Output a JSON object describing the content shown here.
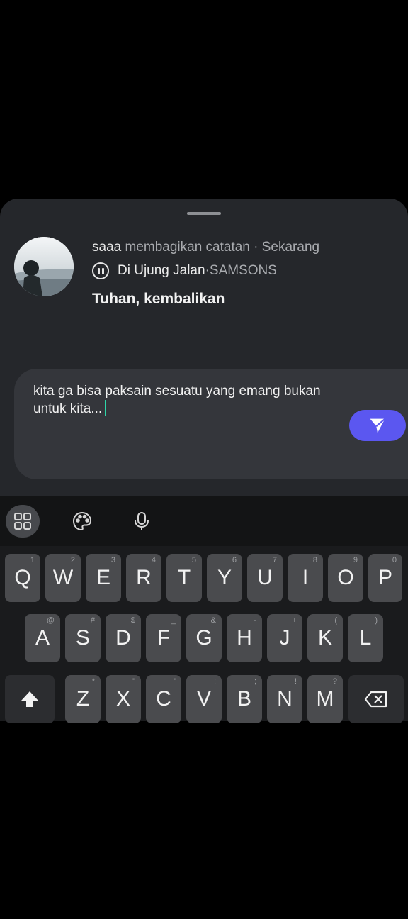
{
  "note": {
    "username": "saaa",
    "action_text": " membagikan catatan · Sekarang",
    "song_title": "Di Ujung Jalan",
    "song_separator": " · ",
    "artist": "SAMSONS",
    "text": "Tuhan, kembalikan"
  },
  "reply": {
    "value": "kita ga bisa paksain sesuatu yang emang bukan untuk kita..."
  },
  "keyboard": {
    "toolbar": [
      "apps-grid-icon",
      "palette-icon",
      "microphone-icon"
    ],
    "row1": [
      {
        "k": "Q",
        "h": "1"
      },
      {
        "k": "W",
        "h": "2"
      },
      {
        "k": "E",
        "h": "3"
      },
      {
        "k": "R",
        "h": "4"
      },
      {
        "k": "T",
        "h": "5"
      },
      {
        "k": "Y",
        "h": "6"
      },
      {
        "k": "U",
        "h": "7"
      },
      {
        "k": "I",
        "h": "8"
      },
      {
        "k": "O",
        "h": "9"
      },
      {
        "k": "P",
        "h": "0"
      }
    ],
    "row2": [
      {
        "k": "A",
        "h": "@"
      },
      {
        "k": "S",
        "h": "#"
      },
      {
        "k": "D",
        "h": "$"
      },
      {
        "k": "F",
        "h": "_"
      },
      {
        "k": "G",
        "h": "&"
      },
      {
        "k": "H",
        "h": "-"
      },
      {
        "k": "J",
        "h": "+"
      },
      {
        "k": "K",
        "h": "("
      },
      {
        "k": "L",
        "h": ")"
      }
    ],
    "row3": [
      {
        "k": "Z",
        "h": "*"
      },
      {
        "k": "X",
        "h": "\""
      },
      {
        "k": "C",
        "h": "'"
      },
      {
        "k": "V",
        "h": ":"
      },
      {
        "k": "B",
        "h": ";"
      },
      {
        "k": "N",
        "h": "!"
      },
      {
        "k": "M",
        "h": "?"
      }
    ]
  },
  "colors": {
    "sheet": "#25272b",
    "reply_box": "#34363b",
    "send_button": "#5b57f0",
    "caret": "#2fd6a8"
  }
}
